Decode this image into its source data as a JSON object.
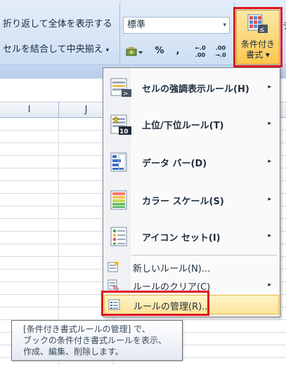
{
  "ribbon": {
    "wrap_text_label": "折り返して全体を表示する",
    "merge_center_label": "セルを結合して中央揃え",
    "merge_center_dropdown": "▾",
    "alignment_group_label_fragment": "",
    "number_format_value": "標準",
    "number_format_arrow": "▾",
    "percent_label": "%",
    "comma_label": ",",
    "increase_decimal_label": "←.0\n.00",
    "decrease_decimal_label": ".00\n→.0",
    "conditional_formatting_label_line1": "条件付き",
    "conditional_formatting_label_line2": "書式 ▾",
    "table_format_fragment": "テ"
  },
  "sheet": {
    "column_headers": [
      "I",
      "J"
    ]
  },
  "menu": {
    "items": [
      {
        "label": "セルの強調表示ルール(H)",
        "icon": "highlight-cells-rules-icon",
        "submenu": true
      },
      {
        "label": "上位/下位ルール(T)",
        "icon": "top-bottom-rules-icon",
        "submenu": true
      },
      {
        "label": "データ バー(D)",
        "icon": "data-bars-icon",
        "submenu": true
      },
      {
        "label": "カラー スケール(S)",
        "icon": "color-scales-icon",
        "submenu": true
      },
      {
        "label": "アイコン セット(I)",
        "icon": "icon-sets-icon",
        "submenu": true
      }
    ],
    "actions": [
      {
        "label": "新しいルール(N)...",
        "icon": "new-rule-icon",
        "submenu": false
      },
      {
        "label": "ルールのクリア(C)",
        "icon": "clear-rules-icon",
        "submenu": true
      },
      {
        "label": "ルールの管理(R)...",
        "icon": "manage-rules-icon",
        "submenu": false
      }
    ],
    "submenu_arrow": "▸"
  },
  "tooltip": {
    "text": "[条件付き書式ルールの管理] で、\nブックの条件付き書式ルールを表示、\n作成、編集、削除します。"
  },
  "colors": {
    "highlight_box": "#e0141e",
    "hover_item": "#fde39a",
    "ribbon_bg": "#d6e4f5"
  }
}
